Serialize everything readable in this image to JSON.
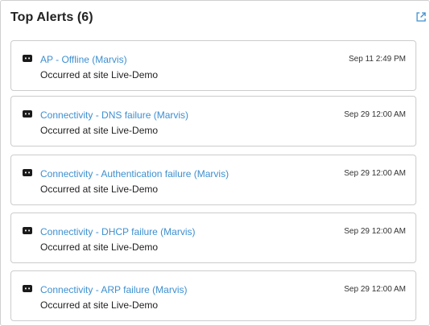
{
  "panel": {
    "title": "Top Alerts (6)",
    "open_icon": "external-link-icon",
    "accent_color": "#3d8fd0"
  },
  "alerts": [
    {
      "title": "AP - Offline (Marvis)",
      "site": "Occurred at site Live-Demo",
      "time": "Sep 11 2:49 PM",
      "icon": "device-icon"
    },
    {
      "title": "Connectivity - DNS failure (Marvis)",
      "site": "Occurred at site Live-Demo",
      "time": "Sep 29 12:00 AM",
      "icon": "device-icon"
    },
    {
      "title": "Connectivity - Authentication failure (Marvis)",
      "site": "Occurred at site Live-Demo",
      "time": "Sep 29 12:00 AM",
      "icon": "device-icon"
    },
    {
      "title": "Connectivity - DHCP failure (Marvis)",
      "site": "Occurred at site Live-Demo",
      "time": "Sep 29 12:00 AM",
      "icon": "device-icon"
    },
    {
      "title": "Connectivity - ARP failure (Marvis)",
      "site": "Occurred at site Live-Demo",
      "time": "Sep 29 12:00 AM",
      "icon": "device-icon"
    }
  ]
}
